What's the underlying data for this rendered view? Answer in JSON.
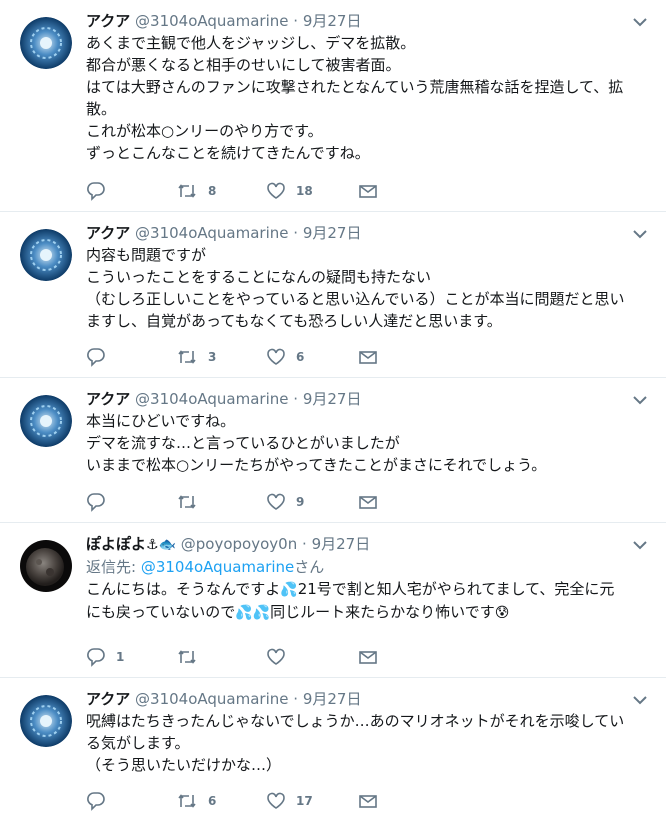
{
  "colors": {
    "accent": "#1da1f2",
    "secondary": "#657786",
    "border": "#e6ecf0",
    "text": "#14171a"
  },
  "icons": {
    "reply": "reply-icon",
    "retweet": "retweet-icon",
    "like": "heart-icon",
    "dm": "envelope-icon",
    "menu": "chevron-down-icon"
  },
  "tweets": [
    {
      "name": "アクア",
      "handle": "@3104oAquamarine",
      "sep": "·",
      "date": "9月27日",
      "lines": [
        "あくまで主観で他人をジャッジし、デマを拡散。",
        "都合が悪くなると相手のせいにして被害者面。",
        "はては大野さんのファンに攻撃されたとなんていう荒唐無稽な話を捏造して、拡",
        "散。",
        "これが松本○ンリーのやり方です。",
        "ずっとこんなことを続けてきたんですね。"
      ],
      "replies": "",
      "retweets": "8",
      "likes": "18"
    },
    {
      "name": "アクア",
      "handle": "@3104oAquamarine",
      "sep": "·",
      "date": "9月27日",
      "lines": [
        "内容も問題ですが",
        "こういったことをすることになんの疑問も持たない",
        "（むしろ正しいことをやっていると思い込んでいる）ことが本当に問題だと思い",
        "ますし、自覚があってもなくても恐ろしい人達だと思います。"
      ],
      "replies": "",
      "retweets": "3",
      "likes": "6"
    },
    {
      "name": "アクア",
      "handle": "@3104oAquamarine",
      "sep": "·",
      "date": "9月27日",
      "lines": [
        "本当にひどいですね。",
        "デマを流すな…と言っているひとがいましたが",
        "いままで松本○ンリーたちがやってきたことがまさにそれでしょう。"
      ],
      "replies": "",
      "retweets": "",
      "likes": "9"
    },
    {
      "name": "ぽよぽよ",
      "name_emoji": "⚓🐟",
      "handle": "@poyopoyoy0n",
      "sep": "·",
      "date": "9月27日",
      "reply_prefix": "返信先: ",
      "reply_handle": "@3104oAquamarine",
      "reply_suffix": "さん",
      "line1_a": "こんにちは。そうなんですよ",
      "line1_emoji": "💦",
      "line1_b": "21号で割と知人宅がやられてまして、完全に元",
      "line2_a": "にも戻っていないので",
      "line2_emoji": "💦💦",
      "line2_b": "同じルート来たらかなり怖いです",
      "line2_emoji_end": "😰",
      "replies": "1",
      "retweets": "",
      "likes": ""
    },
    {
      "name": "アクア",
      "handle": "@3104oAquamarine",
      "sep": "·",
      "date": "9月27日",
      "lines": [
        "呪縛はたちきったんじゃないでしょうか…あのマリオネットがそれを示唆してい",
        "る気がします。",
        "（そう思いたいだけかな…）"
      ],
      "replies": "",
      "retweets": "6",
      "likes": "17"
    }
  ]
}
